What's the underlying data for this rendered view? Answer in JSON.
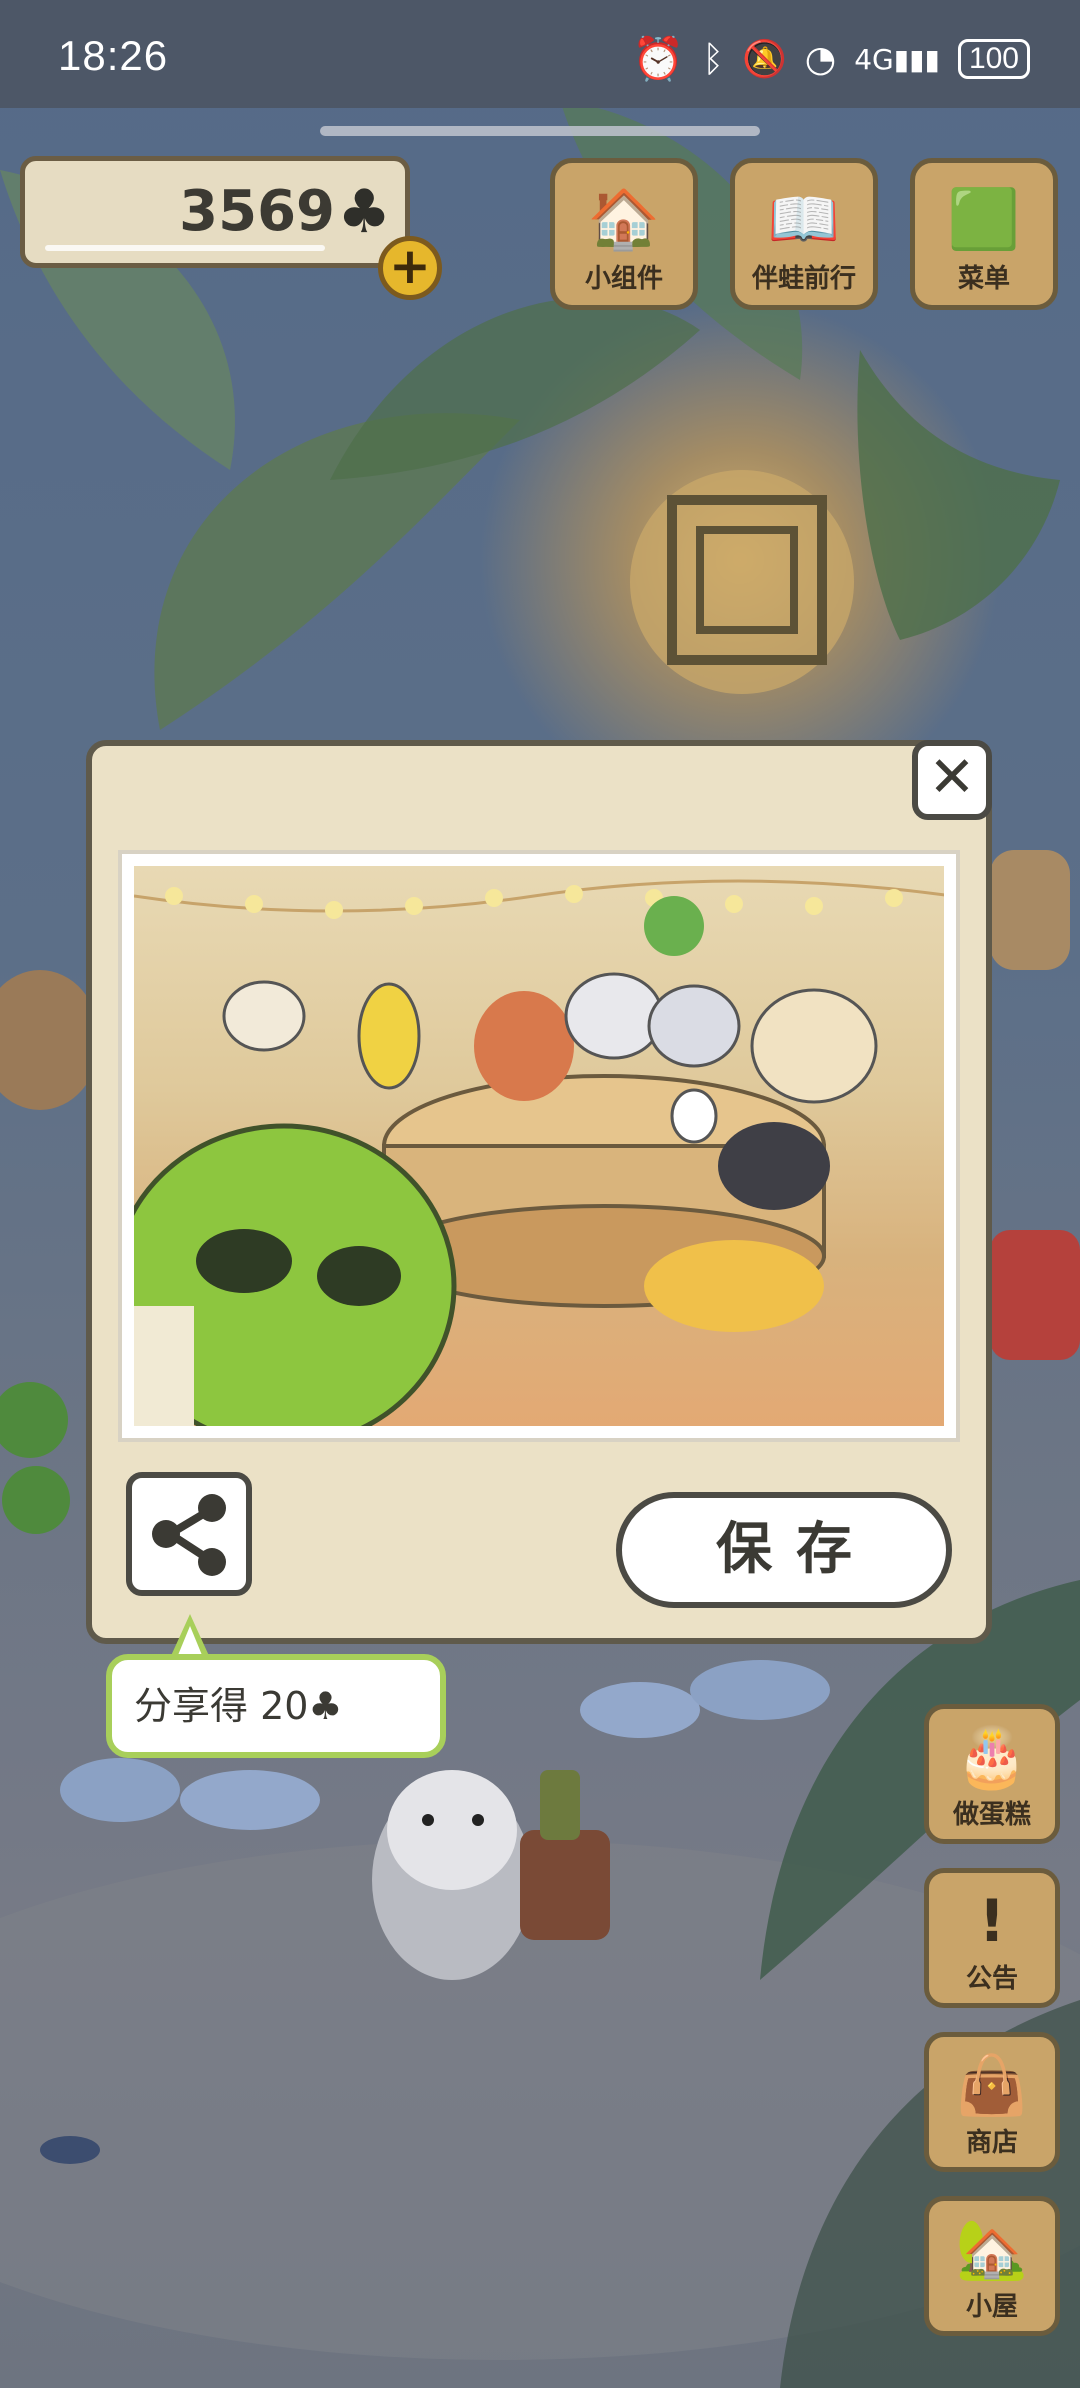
{
  "status_bar": {
    "time": "18:26",
    "battery": "100",
    "network": "4G"
  },
  "currency": {
    "count": "3569",
    "symbol": "♣",
    "add_symbol": "+"
  },
  "top_buttons": [
    {
      "label": "小组件",
      "icon": "widget-icon"
    },
    {
      "label": "伴蛙前行",
      "icon": "book-icon"
    },
    {
      "label": "菜单",
      "icon": "menu-icon"
    }
  ],
  "side_buttons": [
    {
      "label": "做蛋糕",
      "icon": "cake-icon"
    },
    {
      "label": "公告",
      "icon": "exclamation-icon"
    },
    {
      "label": "商店",
      "icon": "bag-icon"
    },
    {
      "label": "小屋",
      "icon": "house-icon"
    }
  ],
  "dialog": {
    "close_symbol": "✕",
    "save_label": "保存",
    "share_tip": "分享得  20♣"
  },
  "colors": {
    "accent_green": "#a8cf5a",
    "wood": "#c9a469",
    "dialog_bg": "#ebe1c6"
  }
}
